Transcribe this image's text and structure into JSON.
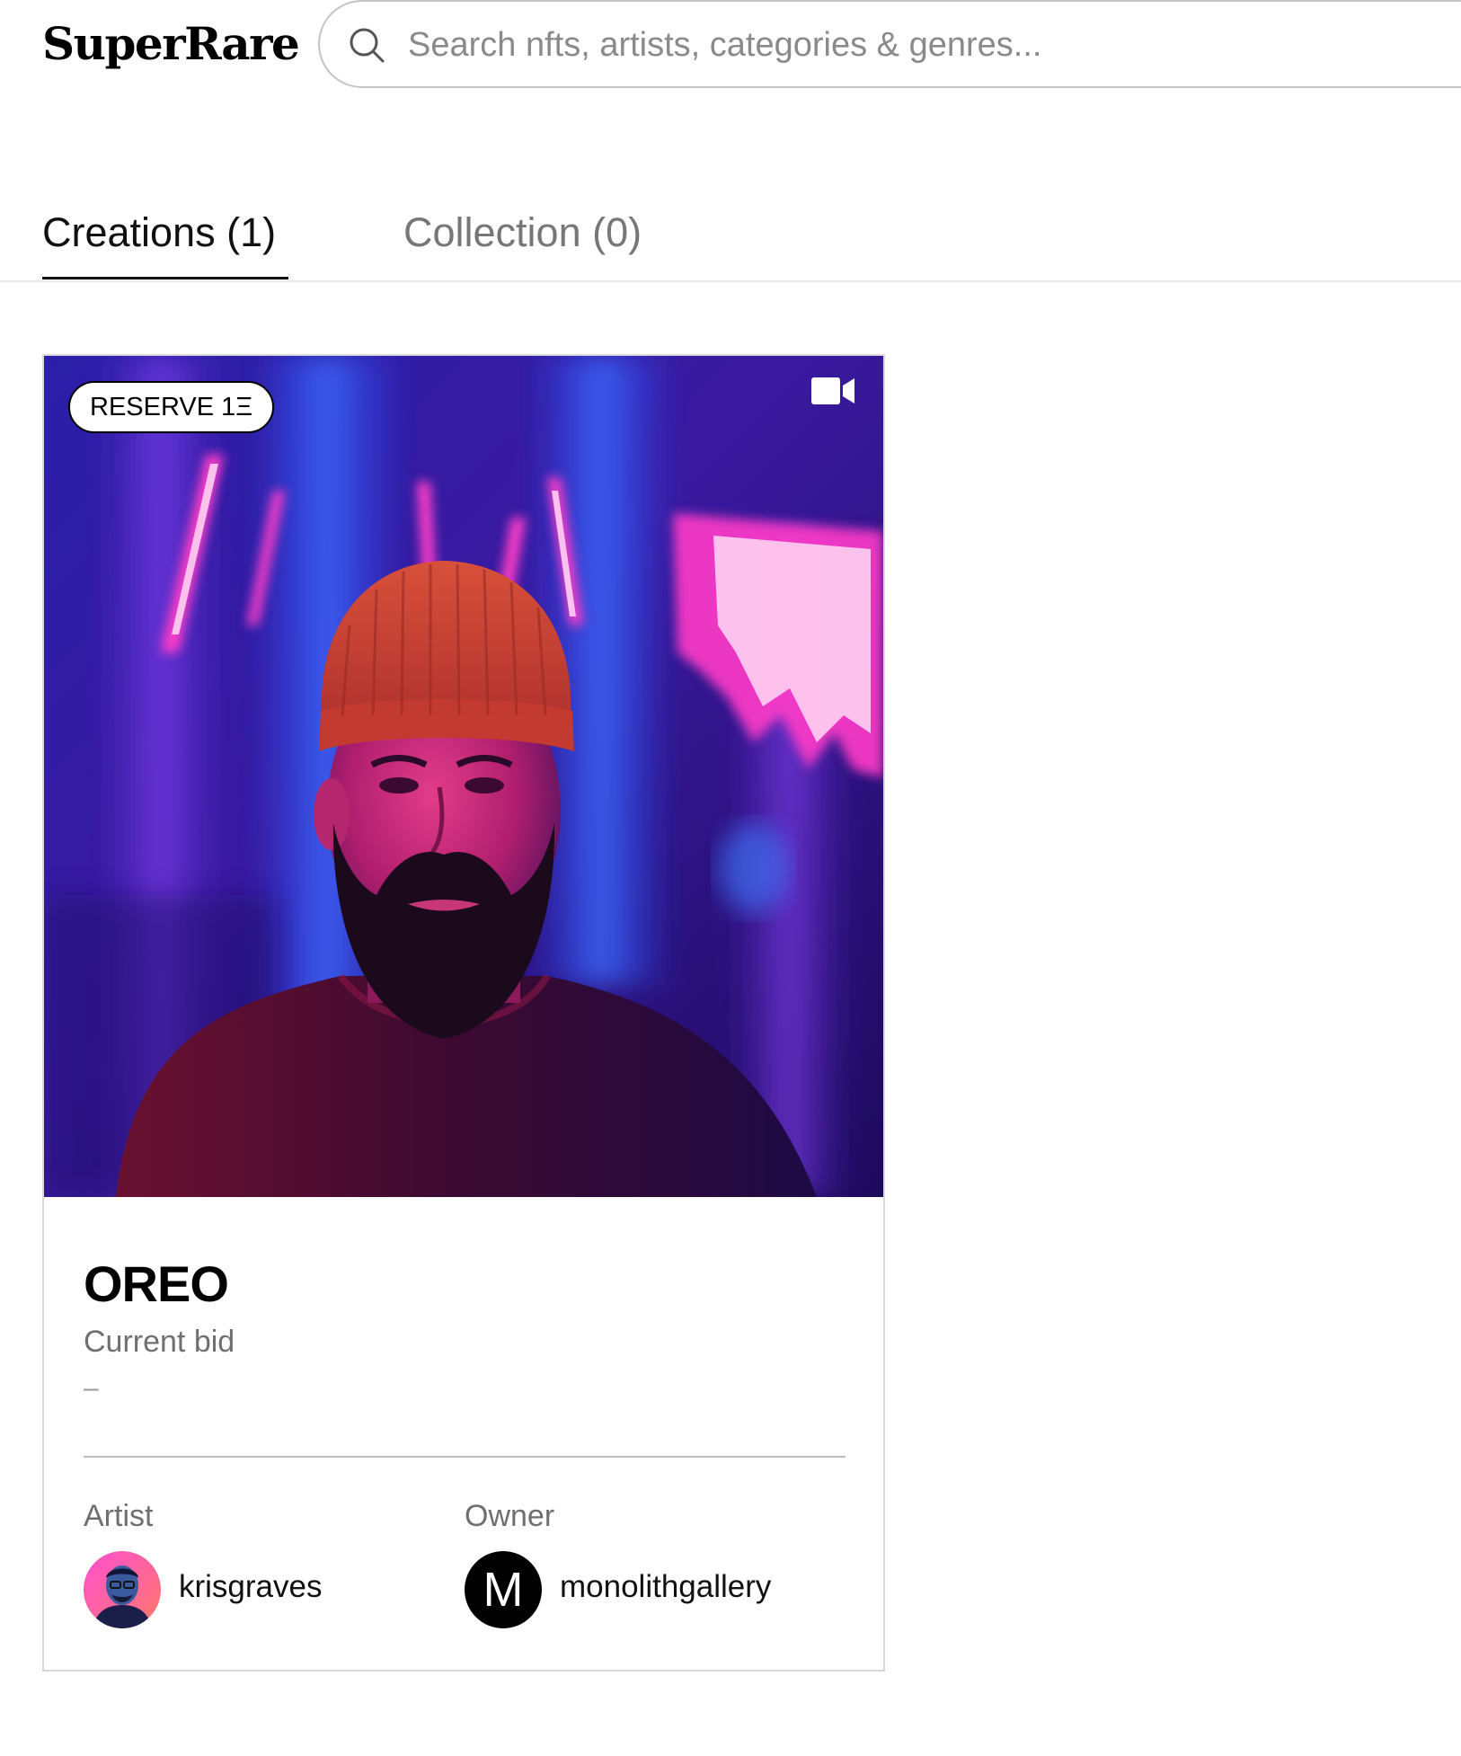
{
  "header": {
    "logo_text": "SuperRare",
    "search_placeholder": "Search nfts, artists, categories & genres..."
  },
  "tabs": [
    {
      "label": "Creations (1)",
      "active": true
    },
    {
      "label": "Collection (0)",
      "active": false
    }
  ],
  "card": {
    "badge": "RESERVE 1Ξ",
    "media_icon": "video-camera-icon",
    "title": "OREO",
    "bid_label": "Current bid",
    "bid_value": "–",
    "artist": {
      "label": "Artist",
      "username": "krisgraves"
    },
    "owner": {
      "label": "Owner",
      "username": "monolithgallery",
      "avatar_letter": "M"
    }
  },
  "colors": {
    "accent": "#000000",
    "muted_text": "#6f6f6f",
    "border": "#d9d9d9",
    "neon_pink": "#ff3cc8",
    "neon_blue": "#2e5bff"
  }
}
